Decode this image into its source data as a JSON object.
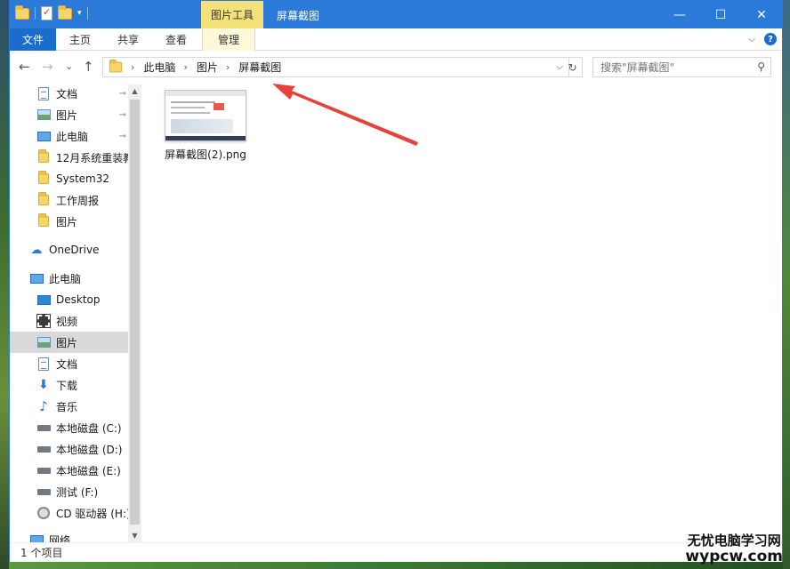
{
  "titlebar": {
    "context_tab": "图片工具",
    "title": "屏幕截图",
    "minimize_glyph": "—",
    "maximize_glyph": "☐",
    "close_glyph": "✕"
  },
  "ribbon": {
    "tabs": [
      "文件",
      "主页",
      "共享",
      "查看",
      "管理"
    ],
    "expand_glyph": "⌵",
    "help_glyph": "?"
  },
  "nav": {
    "back_glyph": "←",
    "forward_glyph": "→",
    "recent_glyph": "⌄",
    "up_glyph": "↑",
    "breadcrumbs": [
      "此电脑",
      "图片",
      "屏幕截图"
    ],
    "crumb_sep_glyph": "›",
    "dropdown_glyph": "⌵",
    "refresh_glyph": "↻",
    "search_placeholder": "搜索\"屏幕截图\"",
    "search_glyph": "⚲"
  },
  "navpane": {
    "quick_access": [
      {
        "label": "文档",
        "icon": "documents-icon",
        "pinned": true
      },
      {
        "label": "图片",
        "icon": "pictures-icon",
        "pinned": true
      },
      {
        "label": "此电脑",
        "icon": "this-pc-icon",
        "pinned": true
      },
      {
        "label": "12月系统重装教",
        "icon": "folder-icon",
        "pinned": false
      },
      {
        "label": "System32",
        "icon": "folder-icon",
        "pinned": false
      },
      {
        "label": "工作周报",
        "icon": "folder-icon",
        "pinned": false
      },
      {
        "label": "图片",
        "icon": "folder-icon",
        "pinned": false
      }
    ],
    "onedrive": "OneDrive",
    "this_pc": "此电脑",
    "pc_items": [
      {
        "label": "Desktop",
        "icon": "desktop-icon"
      },
      {
        "label": "视频",
        "icon": "videos-icon"
      },
      {
        "label": "图片",
        "icon": "pictures-icon",
        "selected": true
      },
      {
        "label": "文档",
        "icon": "documents-icon"
      },
      {
        "label": "下载",
        "icon": "downloads-icon"
      },
      {
        "label": "音乐",
        "icon": "music-icon"
      },
      {
        "label": "本地磁盘 (C:)",
        "icon": "drive-c-icon"
      },
      {
        "label": "本地磁盘 (D:)",
        "icon": "drive-icon"
      },
      {
        "label": "本地磁盘 (E:)",
        "icon": "drive-icon"
      },
      {
        "label": "测试 (F:)",
        "icon": "drive-icon"
      },
      {
        "label": "CD 驱动器 (H:)",
        "icon": "cd-drive-icon"
      }
    ],
    "network": "网络",
    "pin_glyph": "📌",
    "scroll_up_glyph": "▲",
    "scroll_down_glyph": "▼"
  },
  "content": {
    "files": [
      {
        "name": "屏幕截图(2).png",
        "icon": "image-thumbnail"
      }
    ]
  },
  "statusbar": {
    "text": "1 个项目"
  },
  "watermark": {
    "line1": "无忧电脑学习网",
    "line2": "wypcw.com"
  },
  "colors": {
    "titlebar": "#2b79d8",
    "file_tab": "#1a6dcc",
    "context_tab": "#f5e17a",
    "annotation_arrow": "#e8413a",
    "selected_row": "#d9d9d9"
  }
}
